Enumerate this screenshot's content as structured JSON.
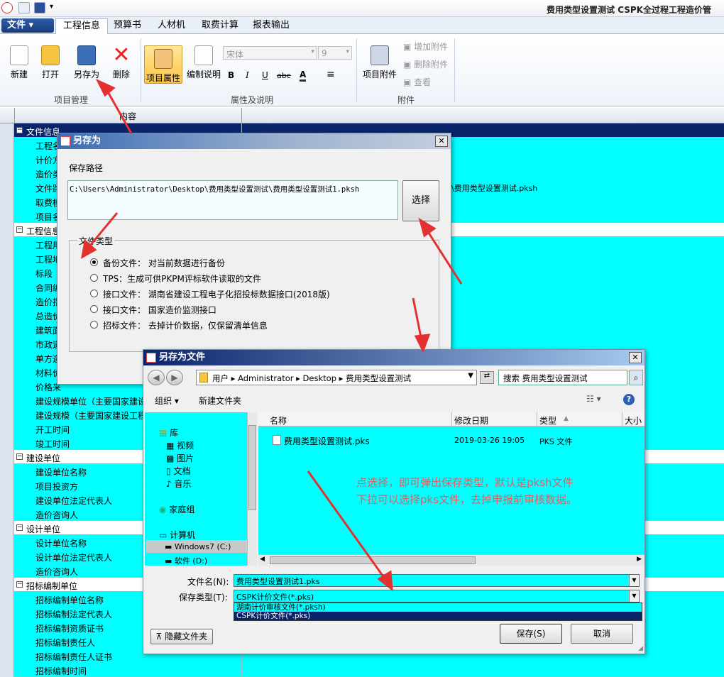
{
  "app": {
    "title": "费用类型设置测试    CSPK全过程工程造价管"
  },
  "tabs": {
    "file": "文件",
    "items": [
      "工程信息",
      "预算书",
      "人材机",
      "取费计算",
      "报表输出"
    ]
  },
  "ribbon": {
    "new": "新建",
    "open": "打开",
    "save_as": "另存为",
    "delete": "删除",
    "group1": "项目管理",
    "project_props": "项目属性",
    "edit_desc": "编制说明",
    "font_name": "宋体",
    "font_size": "9",
    "bold": "B",
    "italic": "I",
    "underline": "U",
    "strike": "abc",
    "fontcolor": "A",
    "align": "≡",
    "group2": "属性及说明",
    "attach": "项目附件",
    "add_attach": "增加附件",
    "del_attach": "删除附件",
    "view_attach": "查看",
    "group3": "附件"
  },
  "grid": {
    "header": "内容",
    "rows": [
      {
        "t": "文件信息",
        "s": true,
        "dark": true
      },
      {
        "t": "工程名",
        "cyan": true
      },
      {
        "t": "计价方",
        "cyan": true
      },
      {
        "t": "造价类",
        "cyan": true
      },
      {
        "t": "文件路",
        "cyan": true,
        "v": "\\费用类型设置测试.pksh"
      },
      {
        "t": "取费模",
        "cyan": true
      },
      {
        "t": "项目名",
        "cyan": true
      },
      {
        "t": "工程信息",
        "s": true
      },
      {
        "t": "工程用",
        "cyan": true
      },
      {
        "t": "工程地",
        "cyan": true
      },
      {
        "t": "标段",
        "cyan": true
      },
      {
        "t": "合同编",
        "cyan": true
      },
      {
        "t": "造价指",
        "cyan": true
      },
      {
        "t": "总造价",
        "cyan": true
      },
      {
        "t": "建筑面",
        "cyan": true
      },
      {
        "t": "市政道",
        "cyan": true
      },
      {
        "t": "单方造",
        "cyan": true
      },
      {
        "t": "材料价",
        "cyan": true
      },
      {
        "t": "价格来",
        "cyan": true
      },
      {
        "t": "建设规模单位（主要国家建设",
        "cyan": true
      },
      {
        "t": "建设规模（主要国家建设工程",
        "cyan": true
      },
      {
        "t": "开工时间",
        "cyan": true
      },
      {
        "t": "竣工时间",
        "cyan": true
      },
      {
        "t": "建设单位",
        "s": true
      },
      {
        "t": "建设单位名称",
        "cyan": true
      },
      {
        "t": "项目投资方",
        "cyan": true
      },
      {
        "t": "建设单位法定代表人",
        "cyan": true
      },
      {
        "t": "造价咨询人",
        "cyan": true
      },
      {
        "t": "设计单位",
        "s": true
      },
      {
        "t": "设计单位名称",
        "cyan": true
      },
      {
        "t": "设计单位法定代表人",
        "cyan": true
      },
      {
        "t": "造价咨询人",
        "cyan": true
      },
      {
        "t": "招标编制单位",
        "s": true
      },
      {
        "t": "招标编制单位名称",
        "cyan": true
      },
      {
        "t": "招标编制法定代表人",
        "cyan": true
      },
      {
        "t": "招标编制资质证书",
        "cyan": true
      },
      {
        "t": "招标编制责任人",
        "cyan": true
      },
      {
        "t": "招标编制责任人证书",
        "cyan": true
      },
      {
        "t": "招标编制时间",
        "cyan": true
      }
    ]
  },
  "saveas": {
    "title": "另存为",
    "path_label": "保存路径",
    "path": "C:\\Users\\Administrator\\Desktop\\费用类型设置测试\\费用类型设置测试1.pksh",
    "choose": "选择",
    "type_label": "文件类型",
    "options": [
      "备份文件：  对当前数据进行备份",
      "TPS：生成可供PKPM评标软件读取的文件",
      "接口文件：  湖南省建设工程电子化招投标数据接口(2018版)",
      "接口文件：  国家造价监测接口",
      "招标文件：  去掉计价数据，仅保留清单信息"
    ]
  },
  "filedlg": {
    "title": "另存为文件",
    "crumbs": "用户 ▸ Administrator ▸ Desktop ▸ 费用类型设置测试",
    "search": "搜索 费用类型设置测试",
    "organize": "组织",
    "new_folder": "新建文件夹",
    "nav": [
      "库",
      "视频",
      "图片",
      "文档",
      "音乐",
      "家庭组",
      "计算机",
      "Windows7 (C:)",
      "软件 (D:)"
    ],
    "cols": {
      "name": "名称",
      "date": "修改日期",
      "type": "类型",
      "size": "大小"
    },
    "file": {
      "name": "费用类型设置测试.pks",
      "date": "2019-03-26 19:05",
      "type": "PKS 文件"
    },
    "note1": "点选择，即可弹出保存类型，默认是pksh文件",
    "note2": "下拉可以选择pks文件，去掉申报前审核数据。",
    "filename_label": "文件名(N):",
    "filename": "费用类型设置测试1.pks",
    "savetype_label": "保存类型(T):",
    "savetype": "CSPK计价文件(*.pks)",
    "opts": [
      "湖南计价审核文件(*.pksh)",
      "CSPK计价文件(*.pks)"
    ],
    "hide": "隐藏文件夹",
    "save": "保存(S)",
    "cancel": "取消"
  }
}
